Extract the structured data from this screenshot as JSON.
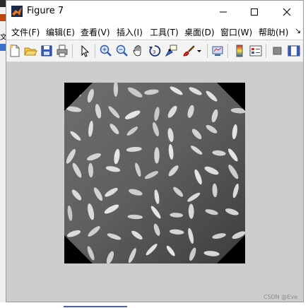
{
  "window": {
    "title": "Figure 7"
  },
  "titlebar_buttons": {
    "minimize": "minimize-icon",
    "maximize": "maximize-icon",
    "close": "close-icon"
  },
  "menu": {
    "items": [
      {
        "label": "文件(F)"
      },
      {
        "label": "编辑(E)"
      },
      {
        "label": "查看(V)"
      },
      {
        "label": "插入(I)"
      },
      {
        "label": "工具(T)"
      },
      {
        "label": "桌面(D)"
      },
      {
        "label": "窗口(W)"
      },
      {
        "label": "帮助(H)"
      }
    ],
    "overflow_glyph": "↘"
  },
  "toolbar": {
    "icons": [
      "new-figure-icon",
      "open-file-icon",
      "save-icon",
      "print-icon",
      "edit-plot-arrow-icon",
      "zoom-in-icon",
      "zoom-out-icon",
      "pan-hand-icon",
      "rotate-3d-icon",
      "data-cursor-icon",
      "brush-icon",
      "brush-dropdown-icon",
      "link-plot-icon",
      "insert-colorbar-icon",
      "insert-legend-icon",
      "hide-plot-tools-icon",
      "show-plot-tools-icon"
    ]
  },
  "figure": {
    "image": "rotated grayscale rice grains image on black background",
    "background_color": "#cdcdcd"
  },
  "watermark": "CSDN @Eve",
  "left_strip_text": "文"
}
